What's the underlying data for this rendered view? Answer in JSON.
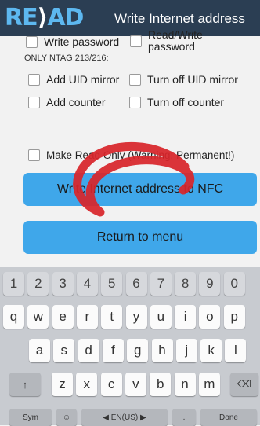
{
  "header": {
    "logo": "RE⟩AD",
    "logo_main": "RE",
    "logo_arrow": "⟩",
    "logo_end": "AD",
    "title": "Write Internet address"
  },
  "options": {
    "write_password": "Write password",
    "read_write_password": "Read/Write password",
    "ntag_note": "ONLY NTAG 213/216:",
    "add_uid_mirror": "Add UID  mirror",
    "turn_off_uid_mirror": "Turn off UID mirror",
    "add_counter": "Add counter",
    "turn_off_counter": "Turn off counter",
    "make_read_only": "Make Read Only (Warning! Permanent!)"
  },
  "buttons": {
    "write_nfc": "Write Internet address to NFC",
    "return_menu": "Return to menu"
  },
  "keyboard": {
    "numbers": [
      "1",
      "2",
      "3",
      "4",
      "5",
      "6",
      "7",
      "8",
      "9",
      "0"
    ],
    "row1": [
      "q",
      "w",
      "e",
      "r",
      "t",
      "y",
      "u",
      "i",
      "o",
      "p"
    ],
    "row2": [
      "a",
      "s",
      "d",
      "f",
      "g",
      "h",
      "j",
      "k",
      "l"
    ],
    "row3": [
      "z",
      "x",
      "c",
      "v",
      "b",
      "n",
      "m"
    ],
    "shift": "↑",
    "backspace": "⌫",
    "sym": "Sym",
    "emoji": "☺",
    "language": "◀ EN(US) ▶",
    "dotcom": ".",
    "done": "Done"
  },
  "colors": {
    "header_bg": "#2b3e53",
    "logo_blue": "#5db8f0",
    "button_blue": "#3fa7ea",
    "scribble_red": "#d8262b"
  }
}
